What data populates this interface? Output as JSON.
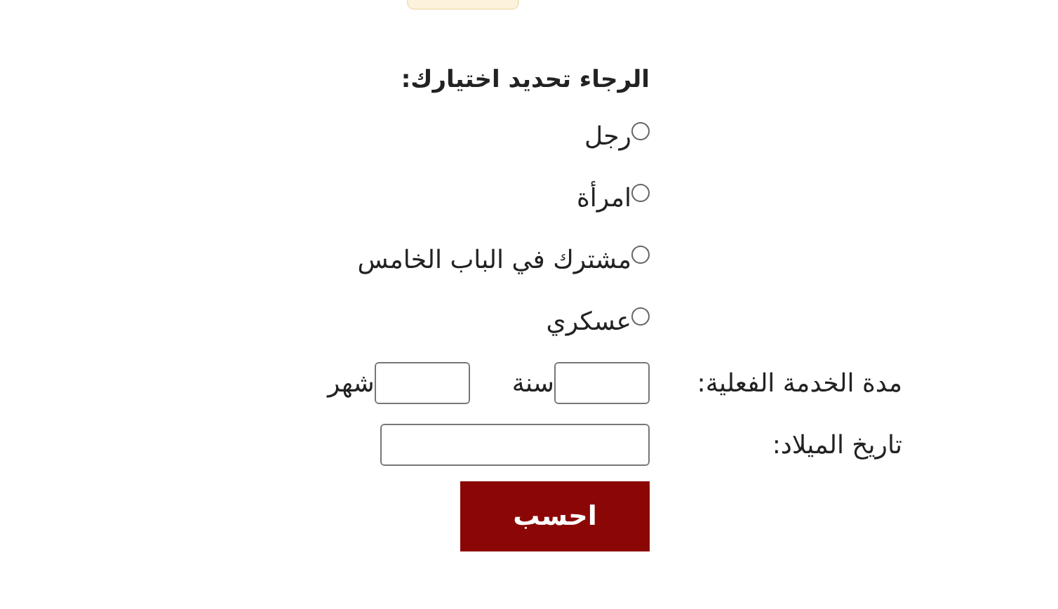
{
  "prompt": "الرجاء تحديد اختيارك:",
  "options": [
    {
      "label": "رجل",
      "selected": false
    },
    {
      "label": "امرأة",
      "selected": false
    },
    {
      "label": "مشترك في الباب الخامس",
      "selected": false
    },
    {
      "label": "عسكري",
      "selected": false
    }
  ],
  "service_duration": {
    "label": "مدة الخدمة الفعلية:",
    "year_unit": "سنة",
    "month_unit": "شهر"
  },
  "birth_date": {
    "label": "تاريخ الميلاد:"
  },
  "button": "احسب"
}
